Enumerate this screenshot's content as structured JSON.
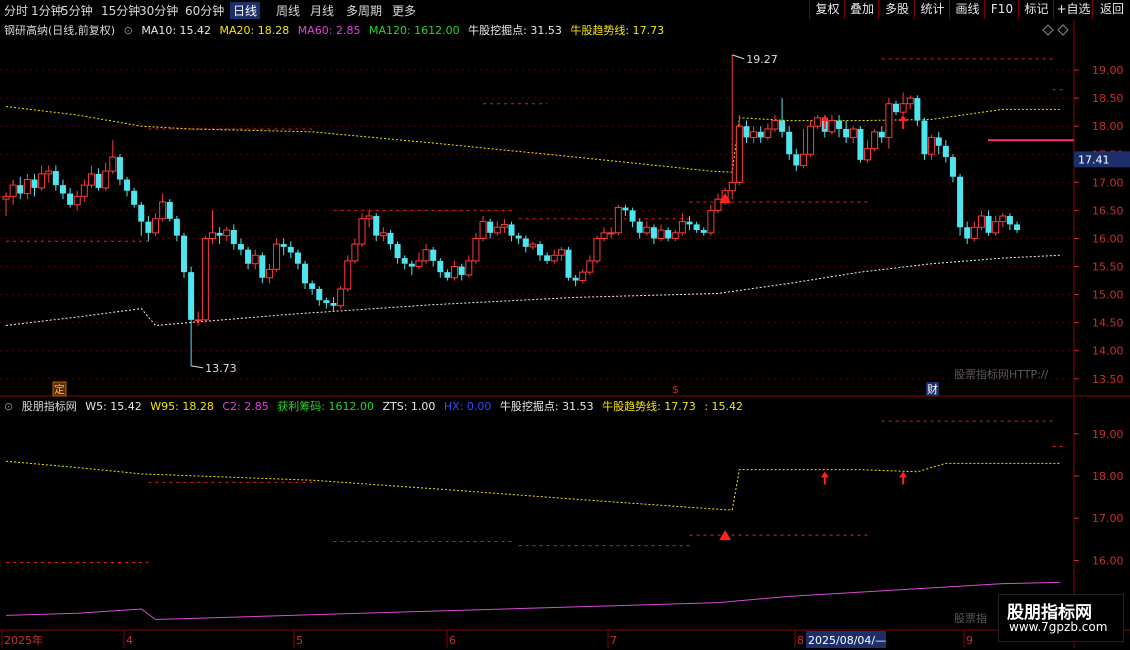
{
  "toolbar": {
    "period_tabs": [
      "分时",
      "1分钟",
      "5分钟",
      "15分钟",
      "30分钟",
      "60分钟",
      "日线",
      "周线",
      "月线",
      "多周期",
      "更多"
    ],
    "active_tab": "日线",
    "right_buttons": [
      "复权",
      "叠加",
      "多股",
      "统计",
      "画线",
      "F10",
      "标记",
      "+自选",
      "返回"
    ]
  },
  "main_legend": {
    "stock": "钢研高纳(日线,前复权)",
    "ma10": "MA10: 15.42",
    "ma20": "MA20: 18.28",
    "ma60": "MA60: 2.85",
    "ma120": "MA120: 1612.00",
    "niugu_dig": "牛股挖掘点: 31.53",
    "niugu_trend": "牛股趋势线: 17.73"
  },
  "sub_legend": {
    "name": "股朋指标网",
    "w5": "W5: 15.42",
    "w95": "W95: 18.28",
    "c2": "C2: 2.85",
    "profit": "获利筹码: 1612.00",
    "zts": "ZTS: 1.00",
    "hx": "HX: 0.00",
    "dig": "牛股挖掘点: 31.53",
    "trend": "牛股趋势线: 17.73",
    "last": ": 15.42"
  },
  "price_axis": {
    "ticks": [
      "19.00",
      "18.50",
      "18.00",
      "17.50",
      "17.00",
      "16.50",
      "16.00",
      "15.50",
      "15.00",
      "14.50",
      "14.00",
      "13.50"
    ],
    "current_price": "17.41"
  },
  "sub_axis": {
    "ticks": [
      "19.00",
      "18.00",
      "17.00",
      "16.00",
      "15.00"
    ]
  },
  "annotations": {
    "high": "19.27",
    "low": "13.73",
    "ding": "定",
    "cai": "财",
    "watermark": "股票指标网HTTP://",
    "watermark2": "股票指"
  },
  "time_axis": {
    "labels": [
      "2025年",
      "4",
      "5",
      "6",
      "7",
      "8",
      "2025/08/04/—",
      "9"
    ]
  },
  "brand": {
    "name": "股朋指标网",
    "url": "www.7gpzb.com"
  },
  "chart_data": {
    "type": "candlestick",
    "ylim": [
      13.3,
      19.5
    ],
    "candles": [
      [
        16.7,
        16.75,
        16.4,
        16.82
      ],
      [
        16.75,
        16.95,
        16.6,
        17.05
      ],
      [
        16.95,
        16.8,
        16.7,
        17.1
      ],
      [
        16.8,
        17.05,
        16.7,
        17.15
      ],
      [
        17.05,
        16.9,
        16.75,
        17.15
      ],
      [
        16.9,
        17.15,
        16.85,
        17.3
      ],
      [
        17.15,
        17.2,
        17.0,
        17.3
      ],
      [
        17.2,
        16.95,
        16.85,
        17.3
      ],
      [
        16.95,
        16.8,
        16.7,
        17.05
      ],
      [
        16.8,
        16.6,
        16.55,
        16.9
      ],
      [
        16.6,
        16.75,
        16.5,
        16.85
      ],
      [
        16.75,
        16.95,
        16.65,
        17.05
      ],
      [
        16.95,
        17.15,
        16.9,
        17.3
      ],
      [
        17.15,
        16.9,
        16.85,
        17.25
      ],
      [
        16.9,
        17.2,
        16.85,
        17.35
      ],
      [
        17.2,
        17.45,
        17.15,
        17.75
      ],
      [
        17.45,
        17.05,
        16.95,
        17.5
      ],
      [
        17.05,
        16.85,
        16.75,
        17.1
      ],
      [
        16.85,
        16.6,
        16.55,
        16.9
      ],
      [
        16.6,
        16.3,
        16.05,
        16.65
      ],
      [
        16.3,
        16.1,
        15.95,
        16.4
      ],
      [
        16.1,
        16.35,
        16.05,
        16.45
      ],
      [
        16.35,
        16.65,
        16.3,
        16.8
      ],
      [
        16.65,
        16.35,
        16.3,
        16.7
      ],
      [
        16.35,
        16.05,
        15.95,
        16.4
      ],
      [
        16.05,
        15.4,
        15.3,
        16.1
      ],
      [
        15.4,
        14.55,
        13.73,
        15.5
      ],
      [
        14.55,
        14.55,
        14.45,
        14.7
      ],
      [
        14.55,
        16.0,
        14.5,
        16.05
      ],
      [
        16.0,
        16.1,
        15.9,
        16.5
      ],
      [
        16.1,
        16.05,
        15.9,
        16.2
      ],
      [
        16.05,
        16.15,
        15.95,
        16.2
      ],
      [
        16.15,
        15.9,
        15.8,
        16.25
      ],
      [
        15.9,
        15.8,
        15.7,
        16.0
      ],
      [
        15.8,
        15.55,
        15.45,
        15.85
      ],
      [
        15.55,
        15.7,
        15.45,
        15.8
      ],
      [
        15.7,
        15.3,
        15.2,
        15.75
      ],
      [
        15.3,
        15.45,
        15.2,
        15.55
      ],
      [
        15.45,
        15.9,
        15.4,
        16.0
      ],
      [
        15.9,
        15.85,
        15.7,
        16.0
      ],
      [
        15.85,
        15.75,
        15.65,
        15.95
      ],
      [
        15.75,
        15.55,
        15.45,
        15.8
      ],
      [
        15.55,
        15.2,
        15.1,
        15.6
      ],
      [
        15.2,
        15.1,
        15.0,
        15.25
      ],
      [
        15.1,
        14.9,
        14.8,
        15.15
      ],
      [
        14.9,
        14.85,
        14.75,
        14.95
      ],
      [
        14.85,
        14.8,
        14.7,
        14.95
      ],
      [
        14.8,
        15.1,
        14.75,
        15.15
      ],
      [
        15.1,
        15.6,
        15.05,
        15.7
      ],
      [
        15.6,
        15.9,
        15.55,
        16.0
      ],
      [
        15.9,
        16.35,
        15.85,
        16.45
      ],
      [
        16.35,
        16.4,
        16.2,
        16.5
      ],
      [
        16.4,
        16.05,
        15.95,
        16.45
      ],
      [
        16.05,
        16.1,
        15.95,
        16.2
      ],
      [
        16.1,
        15.9,
        15.8,
        16.15
      ],
      [
        15.9,
        15.65,
        15.55,
        15.95
      ],
      [
        15.65,
        15.55,
        15.45,
        15.7
      ],
      [
        15.55,
        15.5,
        15.35,
        15.6
      ],
      [
        15.5,
        15.6,
        15.45,
        15.75
      ],
      [
        15.6,
        15.8,
        15.55,
        15.9
      ],
      [
        15.8,
        15.6,
        15.5,
        15.85
      ],
      [
        15.6,
        15.4,
        15.3,
        15.65
      ],
      [
        15.4,
        15.3,
        15.25,
        15.45
      ],
      [
        15.3,
        15.5,
        15.25,
        15.6
      ],
      [
        15.5,
        15.35,
        15.25,
        15.55
      ],
      [
        15.35,
        15.6,
        15.3,
        15.7
      ],
      [
        15.6,
        16.0,
        15.55,
        16.1
      ],
      [
        16.0,
        16.3,
        15.95,
        16.4
      ],
      [
        16.3,
        16.1,
        16.0,
        16.35
      ],
      [
        16.1,
        16.2,
        16.05,
        16.3
      ],
      [
        16.2,
        16.25,
        16.1,
        16.35
      ],
      [
        16.25,
        16.05,
        15.95,
        16.3
      ],
      [
        16.05,
        16.0,
        15.9,
        16.1
      ],
      [
        16.0,
        15.85,
        15.75,
        16.05
      ],
      [
        15.85,
        15.9,
        15.8,
        15.95
      ],
      [
        15.9,
        15.7,
        15.6,
        15.95
      ],
      [
        15.7,
        15.6,
        15.55,
        15.75
      ],
      [
        15.6,
        15.7,
        15.55,
        15.8
      ],
      [
        15.7,
        15.8,
        15.6,
        15.85
      ],
      [
        15.8,
        15.3,
        15.25,
        15.85
      ],
      [
        15.3,
        15.25,
        15.15,
        15.35
      ],
      [
        15.25,
        15.4,
        15.2,
        15.45
      ],
      [
        15.4,
        15.6,
        15.35,
        15.7
      ],
      [
        15.6,
        16.0,
        15.55,
        16.05
      ],
      [
        16.0,
        16.1,
        15.95,
        16.2
      ],
      [
        16.1,
        16.1,
        16.0,
        16.2
      ],
      [
        16.1,
        16.55,
        16.05,
        16.6
      ],
      [
        16.55,
        16.5,
        16.4,
        16.6
      ],
      [
        16.5,
        16.3,
        16.2,
        16.55
      ],
      [
        16.3,
        16.1,
        16.0,
        16.35
      ],
      [
        16.1,
        16.2,
        16.05,
        16.3
      ],
      [
        16.2,
        16.0,
        15.9,
        16.25
      ],
      [
        16.0,
        16.15,
        15.95,
        16.25
      ],
      [
        16.15,
        16.0,
        15.95,
        16.2
      ],
      [
        16.0,
        16.1,
        15.95,
        16.15
      ],
      [
        16.1,
        16.3,
        16.05,
        16.45
      ],
      [
        16.3,
        16.25,
        16.15,
        16.4
      ],
      [
        16.25,
        16.15,
        16.1,
        16.3
      ],
      [
        16.15,
        16.1,
        16.05,
        16.2
      ],
      [
        16.1,
        16.5,
        16.05,
        16.6
      ],
      [
        16.5,
        16.7,
        16.45,
        16.8
      ],
      [
        16.7,
        16.85,
        16.6,
        16.9
      ],
      [
        16.85,
        17.0,
        16.7,
        19.27
      ],
      [
        17.0,
        18.0,
        16.95,
        18.2
      ],
      [
        18.0,
        17.8,
        17.7,
        18.1
      ],
      [
        17.8,
        17.9,
        17.7,
        18.0
      ],
      [
        17.9,
        17.8,
        17.7,
        18.0
      ],
      [
        17.8,
        17.95,
        17.75,
        18.05
      ],
      [
        17.95,
        18.1,
        17.9,
        18.2
      ],
      [
        18.1,
        17.9,
        17.8,
        18.5
      ],
      [
        17.9,
        17.5,
        17.4,
        18.0
      ],
      [
        17.5,
        17.3,
        17.2,
        17.6
      ],
      [
        17.3,
        17.5,
        17.25,
        17.95
      ],
      [
        17.5,
        18.0,
        17.45,
        18.1
      ],
      [
        18.0,
        18.15,
        17.95,
        18.2
      ],
      [
        18.15,
        17.9,
        17.8,
        18.2
      ],
      [
        17.9,
        18.1,
        17.85,
        18.2
      ],
      [
        18.1,
        17.95,
        17.8,
        18.2
      ],
      [
        17.95,
        17.8,
        17.7,
        18.1
      ],
      [
        17.8,
        17.95,
        17.7,
        18.0
      ],
      [
        17.95,
        17.4,
        17.35,
        18.0
      ],
      [
        17.4,
        17.6,
        17.35,
        17.75
      ],
      [
        17.6,
        17.9,
        17.55,
        17.95
      ],
      [
        17.9,
        17.8,
        17.7,
        18.0
      ],
      [
        17.8,
        18.4,
        17.6,
        18.5
      ],
      [
        18.4,
        18.25,
        18.2,
        18.45
      ],
      [
        18.25,
        18.4,
        18.2,
        18.6
      ],
      [
        18.4,
        18.5,
        18.3,
        18.55
      ],
      [
        18.5,
        18.1,
        18.0,
        18.55
      ],
      [
        18.1,
        17.5,
        17.4,
        18.15
      ],
      [
        17.5,
        17.8,
        17.4,
        17.85
      ],
      [
        17.8,
        17.65,
        17.5,
        17.9
      ],
      [
        17.65,
        17.45,
        17.35,
        17.75
      ],
      [
        17.45,
        17.1,
        17.0,
        17.5
      ],
      [
        17.1,
        16.2,
        16.05,
        17.15
      ],
      [
        16.2,
        16.0,
        15.9,
        16.3
      ],
      [
        16.0,
        16.2,
        15.95,
        16.3
      ],
      [
        16.2,
        16.4,
        16.15,
        16.5
      ],
      [
        16.4,
        16.1,
        16.05,
        16.5
      ],
      [
        16.1,
        16.3,
        16.05,
        16.4
      ],
      [
        16.3,
        16.4,
        16.2,
        16.45
      ],
      [
        16.4,
        16.25,
        16.15,
        16.45
      ],
      [
        16.25,
        16.15,
        16.1,
        16.3
      ]
    ],
    "signal_levels": [
      {
        "value": 19.2,
        "from": 123,
        "to": 147
      },
      {
        "value": 18.65,
        "from": 147,
        "to": 149
      },
      {
        "value": 18.4,
        "from": 67,
        "to": 76
      },
      {
        "value": 17.95,
        "from": 20,
        "to": 43
      },
      {
        "value": 16.65,
        "from": 96,
        "to": 121
      },
      {
        "value": 16.5,
        "from": 46,
        "to": 71
      },
      {
        "value": 16.35,
        "from": 72,
        "to": 96
      },
      {
        "value": 15.95,
        "from": 0,
        "to": 20
      }
    ],
    "trend_line": [
      [
        0,
        18.35
      ],
      [
        10,
        18.2
      ],
      [
        19,
        18.0
      ],
      [
        26,
        17.95
      ],
      [
        43,
        17.9
      ],
      [
        60,
        17.7
      ],
      [
        80,
        17.45
      ],
      [
        99,
        17.2
      ],
      [
        102,
        17.18
      ],
      [
        103,
        18.15
      ],
      [
        110,
        18.1
      ],
      [
        120,
        18.1
      ],
      [
        130,
        18.12
      ],
      [
        140,
        18.3
      ],
      [
        148,
        18.3
      ]
    ],
    "lower_line": [
      [
        0,
        14.45
      ],
      [
        10,
        14.6
      ],
      [
        19,
        14.75
      ],
      [
        21,
        14.45
      ],
      [
        40,
        14.65
      ],
      [
        60,
        14.82
      ],
      [
        80,
        14.95
      ],
      [
        100,
        15.02
      ],
      [
        110,
        15.2
      ],
      [
        120,
        15.4
      ],
      [
        130,
        15.55
      ],
      [
        140,
        15.65
      ],
      [
        148,
        15.7
      ]
    ],
    "sub_ylim": [
      14.4,
      19.8
    ],
    "sub_trend": [
      [
        0,
        18.35
      ],
      [
        10,
        18.2
      ],
      [
        19,
        18.05
      ],
      [
        43,
        17.9
      ],
      [
        60,
        17.7
      ],
      [
        80,
        17.45
      ],
      [
        101,
        17.2
      ],
      [
        102,
        17.2
      ],
      [
        103,
        18.15
      ],
      [
        120,
        18.15
      ],
      [
        128,
        18.1
      ],
      [
        132,
        18.3
      ],
      [
        148,
        18.3
      ]
    ],
    "sub_purple": [
      [
        0,
        14.7
      ],
      [
        10,
        14.75
      ],
      [
        19,
        14.85
      ],
      [
        21,
        14.6
      ],
      [
        40,
        14.7
      ],
      [
        60,
        14.8
      ],
      [
        80,
        14.9
      ],
      [
        100,
        15.0
      ],
      [
        110,
        15.15
      ],
      [
        120,
        15.25
      ],
      [
        130,
        15.35
      ],
      [
        140,
        15.45
      ],
      [
        148,
        15.48
      ]
    ],
    "sub_levels": [
      {
        "value": 19.3,
        "from": 123,
        "to": 147
      },
      {
        "value": 18.7,
        "from": 147,
        "to": 149
      },
      {
        "value": 17.85,
        "from": 20,
        "to": 43
      },
      {
        "value": 16.6,
        "from": 96,
        "to": 121
      },
      {
        "value": 16.45,
        "from": 46,
        "to": 71
      },
      {
        "value": 16.35,
        "from": 72,
        "to": 96
      },
      {
        "value": 15.95,
        "from": 0,
        "to": 20
      }
    ]
  }
}
